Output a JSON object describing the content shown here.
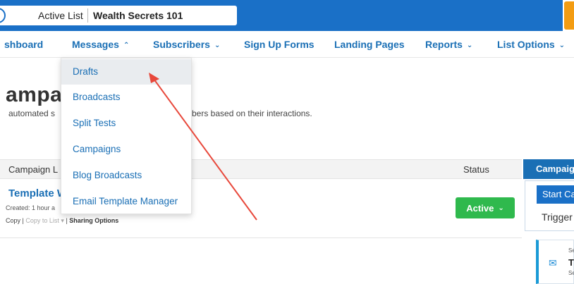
{
  "topbar": {
    "list_label": "Active List",
    "list_name": "Wealth Secrets 101",
    "colors": {
      "bar": "#1a70c7",
      "accent": "#f39c12"
    }
  },
  "nav": {
    "items": [
      {
        "label": "shboard",
        "chevron": ""
      },
      {
        "label": "Messages",
        "chevron": "^"
      },
      {
        "label": "Subscribers",
        "chevron": "v"
      },
      {
        "label": "Sign Up Forms",
        "chevron": ""
      },
      {
        "label": "Landing Pages",
        "chevron": ""
      },
      {
        "label": "Reports",
        "chevron": "v"
      },
      {
        "label": "List Options",
        "chevron": "v"
      }
    ]
  },
  "messages_menu": {
    "items": [
      {
        "label": "Drafts",
        "highlighted": true
      },
      {
        "label": "Broadcasts",
        "highlighted": false
      },
      {
        "label": "Split Tests",
        "highlighted": false
      },
      {
        "label": "Campaigns",
        "highlighted": false
      },
      {
        "label": "Blog Broadcasts",
        "highlighted": false
      },
      {
        "label": "Email Template Manager",
        "highlighted": false
      }
    ]
  },
  "page": {
    "title": "ampai",
    "description_left": "automated s",
    "description_right": "bers based on their interactions."
  },
  "table": {
    "headers": {
      "campaign": "Campaign L",
      "status": "Status"
    },
    "row": {
      "name": "Template W",
      "created": "Created: 1 hour a",
      "copy": "Copy",
      "copy_to_list": "Copy to List",
      "sharing": "Sharing Options",
      "status": "Active",
      "status_color": "#2fb94d"
    }
  },
  "right_panel": {
    "header": "Campaig",
    "start_button": "Start Ca",
    "trigger_label": "Trigger",
    "card": {
      "top": "Se",
      "title": "Tl",
      "bottom": "Se"
    }
  },
  "annotation": {
    "arrow_color": "#e8483b",
    "target": "Drafts"
  }
}
